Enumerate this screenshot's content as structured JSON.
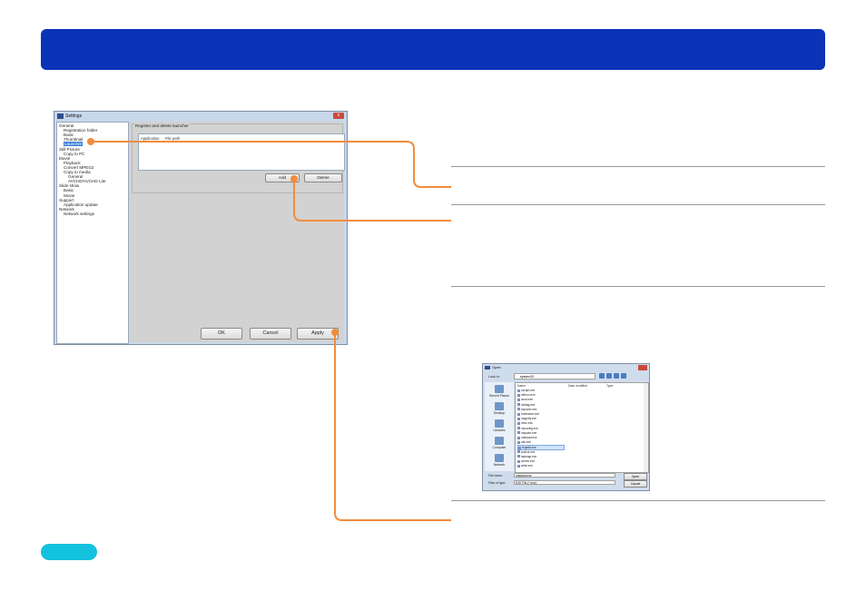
{
  "settings_window": {
    "title": "Settings",
    "close": "x",
    "tree": [
      {
        "label": "General",
        "sign": "⊟"
      },
      {
        "label": "Registration folder",
        "sign": ""
      },
      {
        "label": "Basic",
        "sign": ""
      },
      {
        "label": "Thumbnail",
        "sign": ""
      },
      {
        "label": "Launcher",
        "sign": "",
        "selected": true
      },
      {
        "label": "Still Picture",
        "sign": "⊟"
      },
      {
        "label": "Copy to PC",
        "sign": ""
      },
      {
        "label": "Movie",
        "sign": "⊟"
      },
      {
        "label": "Playback",
        "sign": ""
      },
      {
        "label": "Convert MPEG2",
        "sign": ""
      },
      {
        "label": "Copy to media",
        "sign": "⊟"
      },
      {
        "label": "General",
        "sign": ""
      },
      {
        "label": "AVCHD/AVCHD Lite",
        "sign": ""
      },
      {
        "label": "Slide show",
        "sign": "⊟"
      },
      {
        "label": "Basic",
        "sign": ""
      },
      {
        "label": "Movie",
        "sign": ""
      },
      {
        "label": "Support",
        "sign": "⊟"
      },
      {
        "label": "Application update",
        "sign": ""
      },
      {
        "label": "Network",
        "sign": "⊟"
      },
      {
        "label": "Network settings",
        "sign": ""
      }
    ],
    "group_title": "Register and delete launcher",
    "columns": [
      "Application",
      "File path"
    ],
    "add_button": "Add",
    "delete_button": "Delete",
    "ok_button": "OK",
    "cancel_button": "Cancel",
    "apply_button": "Apply"
  },
  "open_dialog": {
    "title": "Open",
    "look_in_label": "Look in:",
    "look_in_value": "system32",
    "places": [
      "Recent Places",
      "Desktop",
      "Libraries",
      "Computer",
      "Network"
    ],
    "columns": [
      "Name",
      "Date modified",
      "Type"
    ],
    "files": [
      "cscript.exe",
      "ctfmon.exe",
      "dccw.exe",
      "dxdiag.exe",
      "explorer.exe",
      "hostname.exe",
      "magnify.exe",
      "mmc.exe",
      "msconfig.exe",
      "mspaint.exe",
      "notepad.exe",
      "osk.exe",
      "regedit.exe",
      "sndvol.exe",
      "taskmgr.exe",
      "winver.exe",
      "write.exe"
    ],
    "selected_file_index": 12,
    "file_name_label": "File name:",
    "file_name_value": "notepad.exe",
    "file_type_label": "Files of type:",
    "file_type_value": "EXE File (*.exe)",
    "open_button": "Open",
    "cancel_button": "Cancel"
  },
  "colors": {
    "banner": "#0a33b8",
    "accent_connector": "#f28c3c",
    "pill": "#13c2dd"
  }
}
